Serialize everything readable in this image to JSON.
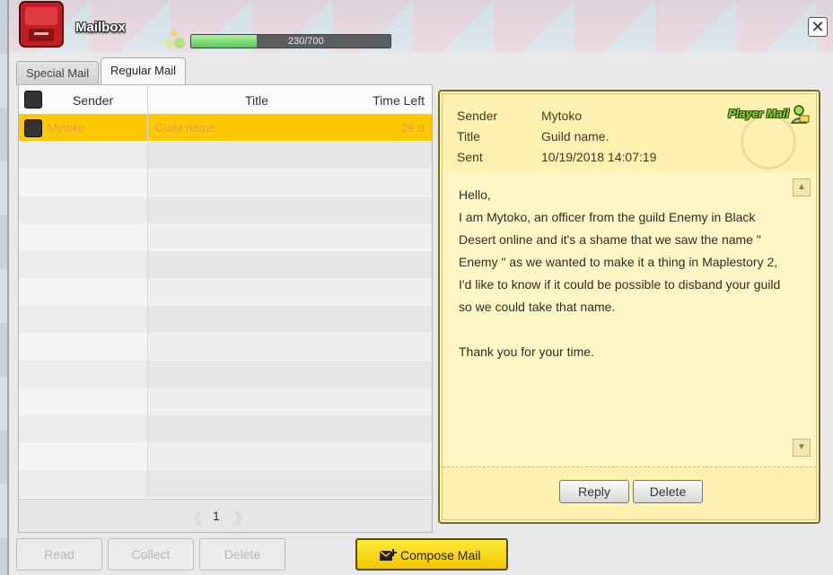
{
  "window": {
    "title": "Mailbox",
    "close_glyph": "✕"
  },
  "xp": {
    "text": "230/700",
    "current": 230,
    "max": 700
  },
  "tabs": [
    {
      "label": "Special Mail",
      "active": false
    },
    {
      "label": "Regular Mail",
      "active": true
    }
  ],
  "list": {
    "headers": {
      "sender": "Sender",
      "title": "Title",
      "time_left": "Time Left"
    },
    "rows": [
      {
        "sender": "Mytoko",
        "title": "Guild name.",
        "time_left": "29 d",
        "selected": true
      }
    ],
    "pagination": {
      "page": "1",
      "prev_glyph": "《",
      "next_glyph": "》"
    }
  },
  "detail": {
    "badge": "Player Mail",
    "sender_label": "Sender",
    "sender": "Mytoko",
    "title_label": "Title",
    "title": "Guild name.",
    "sent_label": "Sent",
    "sent": "10/19/2018 14:07:19",
    "body": "Hello,\nI am Mytoko, an officer from the guild Enemy in Black Desert online and it's a shame that we saw the name \" Enemy \" as we wanted to make it a thing in Maplestory 2, I'd like to know if it could be possible to disband your guild so we could take that name.\n\nThank you for your time.",
    "scroll_up_glyph": "▲",
    "scroll_down_glyph": "▼",
    "reply_label": "Reply",
    "delete_label": "Delete"
  },
  "actions": {
    "read_label": "Read",
    "collect_label": "Collect",
    "delete_label": "Delete",
    "compose_label": "Compose Mail"
  },
  "colors": {
    "selected_row": "#ffc800",
    "compose_button": "#f5d200",
    "mail_paper": "#fff3b8",
    "player_mail_green": "#8ed63a"
  },
  "icons": [
    "mailbox-icon",
    "close-icon",
    "player-mail-icon",
    "compose-mail-icon",
    "checkbox-icon"
  ]
}
